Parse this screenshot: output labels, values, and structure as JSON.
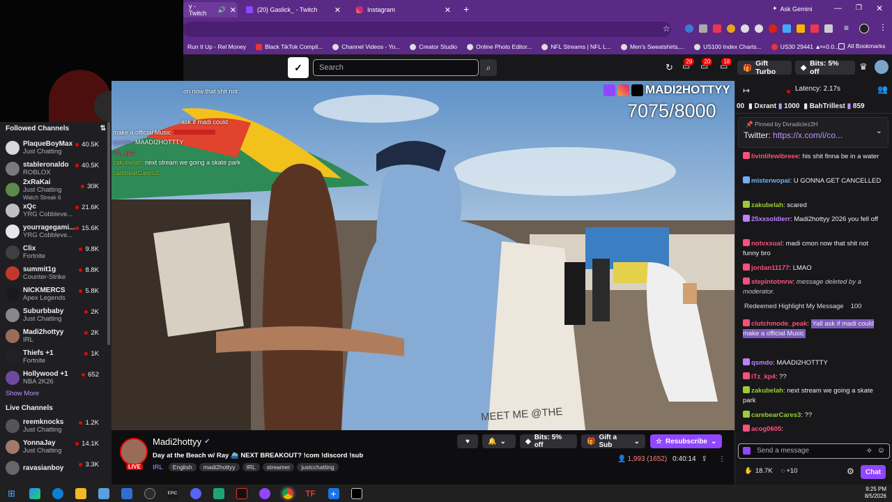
{
  "browser": {
    "tabs": [
      {
        "label": "y - Twitch",
        "active": true
      },
      {
        "label": "(20) Gaslick_ - Twitch",
        "active": false
      },
      {
        "label": "Instagram",
        "active": false
      }
    ],
    "ask_gemini": "Ask Gemini",
    "bookmarks": [
      "Run It Up - Rel Money",
      "Black TikTok Compil...",
      "Channel Videos - Yo...",
      "Creator Studio",
      "Online Photo Editor...",
      "NFL Streams | NFL L...",
      "Men's Sweatshirts,...",
      "US100 Index Charts...",
      "US30 29441 ▲ +0.0..."
    ],
    "all_bookmarks": "All Bookmarks"
  },
  "header": {
    "search_placeholder": "Search",
    "badges": [
      "29",
      "20",
      "18"
    ],
    "gift_turbo": "Gift Turbo",
    "bits": "Bits: 5% off"
  },
  "sidebar": {
    "followed_title": "Followed Channels",
    "followed": [
      {
        "name": "PlaqueBoyMax",
        "game": "Just Chatting",
        "viewers": "40.5K",
        "color": "#d8d8d8"
      },
      {
        "name": "stableronaldo",
        "game": "ROBLOX",
        "viewers": "40.5K",
        "color": "#7a7a7a"
      },
      {
        "name": "2xRaKai",
        "game": "Just Chatting",
        "extra": "Watch Streak 6",
        "viewers": "30K",
        "color": "#5b8a4a"
      },
      {
        "name": "xQc",
        "game": "YRG Cobbleve...",
        "viewers": "21.6K",
        "color": "#bfbfbf"
      },
      {
        "name": "yourragegami...",
        "game": "YRG Cobbleve...",
        "viewers": "15.6K",
        "color": "#e7e7e7"
      },
      {
        "name": "Clix",
        "game": "Fortnite",
        "viewers": "9.8K",
        "color": "#3f3f3f"
      },
      {
        "name": "summit1g",
        "game": "Counter-Strike",
        "viewers": "8.8K",
        "color": "#c0392b"
      },
      {
        "name": "NICKMERCS",
        "game": "Apex Legends",
        "viewers": "5.8K",
        "color": "#1a1a1a"
      },
      {
        "name": "Suburbbaby",
        "game": "Just Chatting",
        "viewers": "2K",
        "color": "#888"
      },
      {
        "name": "Madi2hottyy",
        "game": "IRL",
        "viewers": "2K",
        "color": "#9b6b5a"
      },
      {
        "name": "Thiefs +1",
        "game": "Fortnite",
        "viewers": "1K",
        "color": "#222"
      },
      {
        "name": "Hollywood +1",
        "game": "NBA 2K26",
        "viewers": "652",
        "color": "#6c4aa0"
      }
    ],
    "show_more": "Show More",
    "live_title": "Live Channels",
    "live": [
      {
        "name": "reemknocks",
        "game": "Just Chatting",
        "viewers": "1.2K",
        "color": "#555"
      },
      {
        "name": "YonnaJay",
        "game": "Just Chatting",
        "viewers": "14.1K",
        "color": "#a3796a"
      },
      {
        "name": "ravasianboy",
        "game": "",
        "viewers": "3.3K",
        "color": "#666"
      }
    ]
  },
  "video": {
    "brand": "MADI2HOTTYY",
    "goal": "7075/8000",
    "tote_text": "MEET ME @THE",
    "overlay_top": "on now that shit not",
    "overlay_chat": [
      {
        "user": "",
        "text": "ask if madi could"
      },
      {
        "user": "",
        "text": "make a official Music"
      },
      {
        "user": "qsmdo:",
        "text": "MAADI2HOTTTY"
      },
      {
        "user": "iTz_kp4",
        "text": ""
      },
      {
        "user": "zakubelah:",
        "text": "next stream we going a skate park"
      },
      {
        "user": "carebearCares3:",
        "text": ""
      }
    ]
  },
  "stream": {
    "channel": "Madi2hottyy",
    "title": "Day at the Beach w/ Ray ⛴️ NEXT BREAKOUT? !com !discord !sub",
    "category": "IRL",
    "tags": [
      "English",
      "madi2hottyy",
      "IRL",
      "streamer",
      "justcchatting"
    ],
    "live": "LIVE",
    "bits": "Bits: 5% off",
    "gift": "Gift a Sub",
    "resub": "Resubscribe",
    "viewers": "1,993 (1652)",
    "uptime": "0:40:14"
  },
  "chat": {
    "latency": "Latency: 2.17s",
    "leaderboard": [
      {
        "name": "Dxrant",
        "bits": "1000"
      },
      {
        "name": "BahTrillest",
        "bits": "859"
      }
    ],
    "leader_prefix": "00",
    "pinned_by": "Pinned by",
    "pinned_user": "Dvradiclez2H",
    "pinned_label": "Twitter:",
    "pinned_link": "https://x.com/i/co...",
    "messages": [
      {
        "user": "livinlifewibreee",
        "color": "#ff4f7b",
        "text": "his shit finna be in a water"
      },
      {
        "user": "misterwopai",
        "color": "#6fb1ff",
        "text": "U GONNA GET CANCELLED"
      },
      {
        "user": "zakubelah",
        "color": "#9acd32",
        "text": "scared"
      },
      {
        "user": "25xxsoldierr",
        "color": "#bf7fff",
        "text": "Madi2hottyy 2026 you fell off"
      },
      {
        "user": "notvxsual",
        "color": "#ff4f7b",
        "text": "madi cmon now that shit not funny bro"
      },
      {
        "user": "jordan11177",
        "color": "#ff4f7b",
        "text": "LMAO"
      },
      {
        "user": "stepintotmrw",
        "color": "#ff4f7b",
        "text": "message deleted by a moderator."
      },
      {
        "user": "",
        "color": "",
        "text": "Redeemed Highlight My Message"
      },
      {
        "user": "clutchmode_peak",
        "color": "#ff4f7b",
        "text": "Yall ask if madi could make a official Music"
      },
      {
        "user": "qsmdo",
        "color": "#bf7fff",
        "text": "MAADI2HOTTTY"
      },
      {
        "user": "iTz_kp4",
        "color": "#ff4f7b",
        "text": "??"
      },
      {
        "user": "zakubelah",
        "color": "#9acd32",
        "text": "next stream we going a skate park"
      },
      {
        "user": "carebearCares3",
        "color": "#9acd32",
        "text": "??"
      },
      {
        "user": "acog0605",
        "color": "#ff4f7b",
        "text": ""
      }
    ],
    "redeem_cost": "100",
    "placeholder": "Send a message",
    "points": "18.7K",
    "plus": "+10",
    "chat_btn": "Chat"
  },
  "taskbar": {
    "time": "9:25 PM",
    "date": "8/5/2026"
  }
}
